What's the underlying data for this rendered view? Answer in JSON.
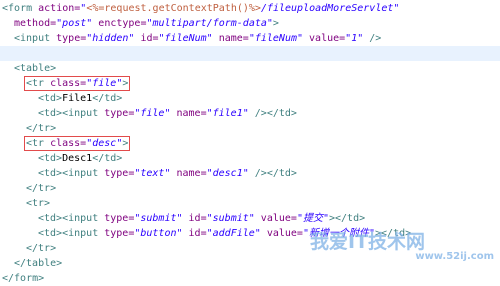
{
  "code_lines": [
    {
      "indent": 0,
      "highlight": false,
      "tokens": [
        {
          "t": "<",
          "c": "tag"
        },
        {
          "t": "form",
          "c": "tag"
        },
        {
          "t": " action=",
          "c": "attr"
        },
        {
          "t": "\"",
          "c": "val"
        },
        {
          "t": "<%=request.getContextPath()%>",
          "c": "jsp"
        },
        {
          "t": "/fileuploadMoreServlet\"",
          "c": "val"
        }
      ]
    },
    {
      "indent": 2,
      "highlight": false,
      "tokens": [
        {
          "t": "method=",
          "c": "attr"
        },
        {
          "t": "\"post\"",
          "c": "val"
        },
        {
          "t": " enctype=",
          "c": "attr"
        },
        {
          "t": "\"multipart/form-data\"",
          "c": "val"
        },
        {
          "t": ">",
          "c": "tag"
        }
      ]
    },
    {
      "indent": 2,
      "highlight": false,
      "tokens": [
        {
          "t": "<input",
          "c": "tag"
        },
        {
          "t": " type=",
          "c": "attr"
        },
        {
          "t": "\"hidden\"",
          "c": "val"
        },
        {
          "t": " id=",
          "c": "attr"
        },
        {
          "t": "\"fileNum\"",
          "c": "val"
        },
        {
          "t": " name=",
          "c": "attr"
        },
        {
          "t": "\"fileNum\"",
          "c": "val"
        },
        {
          "t": " value=",
          "c": "attr"
        },
        {
          "t": "\"1\"",
          "c": "val"
        },
        {
          "t": " />",
          "c": "tag"
        }
      ]
    },
    {
      "indent": 0,
      "highlight": true,
      "tokens": []
    },
    {
      "indent": 2,
      "highlight": false,
      "tokens": [
        {
          "t": "<table>",
          "c": "tag"
        }
      ]
    },
    {
      "indent": 4,
      "highlight": false,
      "boxed": true,
      "tokens": [
        {
          "t": "<tr",
          "c": "tag"
        },
        {
          "t": " class=",
          "c": "attr"
        },
        {
          "t": "\"file\"",
          "c": "val"
        },
        {
          "t": ">",
          "c": "tag"
        }
      ]
    },
    {
      "indent": 6,
      "highlight": false,
      "tokens": [
        {
          "t": "<td>",
          "c": "tag"
        },
        {
          "t": "File1",
          "c": "txt"
        },
        {
          "t": "</td>",
          "c": "tag"
        }
      ]
    },
    {
      "indent": 6,
      "highlight": false,
      "tokens": [
        {
          "t": "<td>",
          "c": "tag"
        },
        {
          "t": "<input",
          "c": "tag"
        },
        {
          "t": " type=",
          "c": "attr"
        },
        {
          "t": "\"file\"",
          "c": "val"
        },
        {
          "t": " name=",
          "c": "attr"
        },
        {
          "t": "\"file1\"",
          "c": "val"
        },
        {
          "t": " />",
          "c": "tag"
        },
        {
          "t": "</td>",
          "c": "tag"
        }
      ]
    },
    {
      "indent": 4,
      "highlight": false,
      "tokens": [
        {
          "t": "</tr>",
          "c": "tag"
        }
      ]
    },
    {
      "indent": 4,
      "highlight": false,
      "boxed": true,
      "tokens": [
        {
          "t": "<tr",
          "c": "tag"
        },
        {
          "t": " class=",
          "c": "attr"
        },
        {
          "t": "\"desc\"",
          "c": "val"
        },
        {
          "t": ">",
          "c": "tag"
        }
      ]
    },
    {
      "indent": 6,
      "highlight": false,
      "tokens": [
        {
          "t": "<td>",
          "c": "tag"
        },
        {
          "t": "Desc1",
          "c": "txt"
        },
        {
          "t": "</td>",
          "c": "tag"
        }
      ]
    },
    {
      "indent": 6,
      "highlight": false,
      "tokens": [
        {
          "t": "<td>",
          "c": "tag"
        },
        {
          "t": "<input",
          "c": "tag"
        },
        {
          "t": " type=",
          "c": "attr"
        },
        {
          "t": "\"text\"",
          "c": "val"
        },
        {
          "t": " name=",
          "c": "attr"
        },
        {
          "t": "\"desc1\"",
          "c": "val"
        },
        {
          "t": " />",
          "c": "tag"
        },
        {
          "t": "</td>",
          "c": "tag"
        }
      ]
    },
    {
      "indent": 4,
      "highlight": false,
      "tokens": [
        {
          "t": "</tr>",
          "c": "tag"
        }
      ]
    },
    {
      "indent": 4,
      "highlight": false,
      "tokens": [
        {
          "t": "<tr>",
          "c": "tag"
        }
      ]
    },
    {
      "indent": 6,
      "highlight": false,
      "tokens": [
        {
          "t": "<td>",
          "c": "tag"
        },
        {
          "t": "<input",
          "c": "tag"
        },
        {
          "t": " type=",
          "c": "attr"
        },
        {
          "t": "\"submit\"",
          "c": "val"
        },
        {
          "t": " id=",
          "c": "attr"
        },
        {
          "t": "\"submit\"",
          "c": "val"
        },
        {
          "t": " value=",
          "c": "attr"
        },
        {
          "t": "\"提交\"",
          "c": "val"
        },
        {
          "t": ">",
          "c": "tag"
        },
        {
          "t": "</td>",
          "c": "tag"
        }
      ]
    },
    {
      "indent": 6,
      "highlight": false,
      "tokens": [
        {
          "t": "<td>",
          "c": "tag"
        },
        {
          "t": "<input",
          "c": "tag"
        },
        {
          "t": " type=",
          "c": "attr"
        },
        {
          "t": "\"button\"",
          "c": "val"
        },
        {
          "t": " id=",
          "c": "attr"
        },
        {
          "t": "\"addFile\"",
          "c": "val"
        },
        {
          "t": " value=",
          "c": "attr"
        },
        {
          "t": "\"新增一个附件\"",
          "c": "val"
        },
        {
          "t": ">",
          "c": "tag"
        },
        {
          "t": "</td>",
          "c": "tag"
        }
      ]
    },
    {
      "indent": 4,
      "highlight": false,
      "tokens": [
        {
          "t": "</tr>",
          "c": "tag"
        }
      ]
    },
    {
      "indent": 2,
      "highlight": false,
      "tokens": [
        {
          "t": "</table>",
          "c": "tag"
        }
      ]
    },
    {
      "indent": 0,
      "highlight": false,
      "tokens": [
        {
          "t": "</form>",
          "c": "tag"
        }
      ]
    }
  ],
  "watermark": {
    "text": "我爱IT技术网",
    "url": "www.52ij.com"
  },
  "colors": {
    "tag": "#3f7f7f",
    "attribute": "#7f007f",
    "value": "#2a00ff",
    "jsp": "#bf5f3f",
    "highlight_line": "#e8f2fe",
    "annotation_box": "#e24b4b"
  }
}
